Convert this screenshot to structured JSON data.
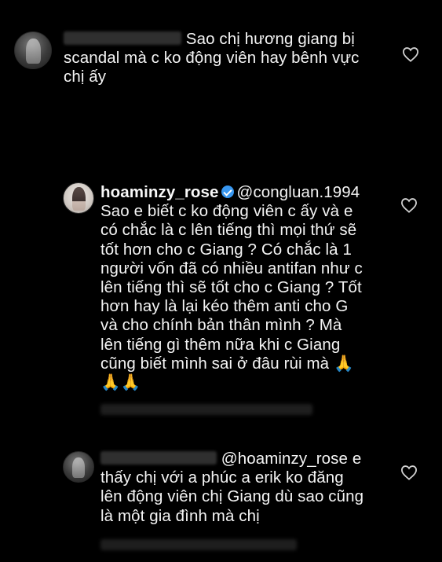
{
  "comments": [
    {
      "text_line1": "Sao chị hương giang bị",
      "text_line2": "scandal mà c ko động viên hay bênh vực",
      "text_line3": "chị ấy"
    },
    {
      "username": "hoaminzy_rose",
      "mention": "@congluan.1994",
      "lines": [
        "Sao e biết c ko động viên c ấy và e",
        "có chắc là c lên tiếng thì mọi thứ sẽ",
        "tốt hơn cho c Giang ? Có chắc là 1",
        "người vốn đã có nhiều antifan như c",
        "lên tiếng thì sẽ tốt cho c Giang ? Tốt",
        "hơn hay là lại kéo thêm anti cho G",
        "và cho chính bản thân mình ? Mà",
        "lên tiếng gì thêm nữa khi c Giang",
        "cũng biết mình sai ở đâu rùi mà 🙏",
        "🙏🙏"
      ]
    },
    {
      "mention": "@hoaminzy_rose e",
      "lines": [
        "thấy chị với a phúc a erik ko đăng",
        "lên động viên chị Giang dù sao cũng",
        "là một gia đình mà chị"
      ]
    }
  ],
  "icons": {
    "heart": "heart-icon",
    "verified": "verified-badge-icon"
  }
}
